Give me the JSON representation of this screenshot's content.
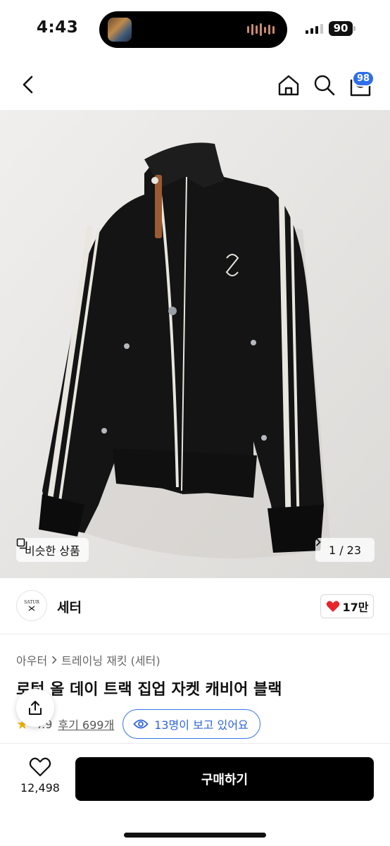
{
  "status_bar": {
    "time": "4:43",
    "battery": "90",
    "icons": [
      "signal-icon",
      "battery-icon",
      "now-playing-waveform-icon"
    ]
  },
  "nav": {
    "cart_badge": "98",
    "icons": [
      "back-chevron-icon",
      "home-icon",
      "search-icon",
      "cart-icon"
    ]
  },
  "gallery": {
    "similar_label": "비슷한 상품",
    "pager": "1 / 23",
    "progress": {
      "current": 1,
      "total": 23
    }
  },
  "store": {
    "logo_text": "SATUR",
    "name": "세터",
    "likes": "17만"
  },
  "product": {
    "breadcrumb": [
      "아우터",
      "트레이닝 재킷 (세터)"
    ],
    "title": "로턴 올 데이 트랙 집업 자켓 캐비어 블랙",
    "rating": "4.9",
    "reviews": "후기 699개",
    "viewers": "13명이 보고 있어요"
  },
  "bottom": {
    "wish_count": "12,498",
    "buy_label": "구매하기"
  },
  "colors": {
    "accent_blue": "#2f6ee8",
    "heart_red": "#e8242b",
    "star_yellow": "#f5b400",
    "buy_button": "#000000"
  }
}
